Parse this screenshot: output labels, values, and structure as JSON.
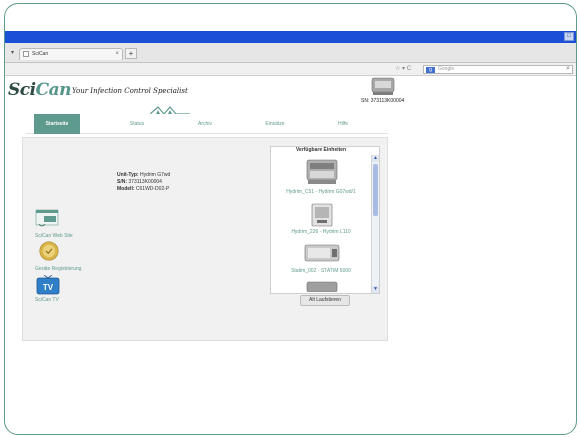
{
  "browser": {
    "tab_title": "SciCan",
    "new_tab_label": "+",
    "search_placeholder": "Google",
    "window_button": "□"
  },
  "header": {
    "logo_main": "Sci",
    "logo_accent": "Can",
    "tagline": "Your Infection Control Specialist",
    "serial_label": "SN: 373113K00004"
  },
  "menu": {
    "items": [
      {
        "label": "Startseite"
      },
      {
        "label": "Status"
      },
      {
        "label": "Archiv"
      },
      {
        "label": "Einsätze"
      },
      {
        "label": "Hilfe"
      }
    ]
  },
  "unit_info": {
    "type_key": "Unit-Typ:",
    "type_value": "Hydrim G7wd",
    "sn_key": "S/N:",
    "sn_value": "373113K00004",
    "model_key": "Modell:",
    "model_value": "C61WD-D02-P"
  },
  "sidebar": {
    "links": [
      {
        "label": "SciCan Web Site",
        "icon": "website-icon"
      },
      {
        "label": "Geräte Registrierung",
        "icon": "registration-seal-icon"
      },
      {
        "label": "SciCan TV",
        "icon": "tv-icon"
      }
    ]
  },
  "available_units": {
    "title": "Verfügbare Einheiten",
    "items": [
      {
        "label": "Hydrim_C51 - Hydrim G07wd/1"
      },
      {
        "label": "Hydrim_226 - Hydrim L110"
      },
      {
        "label": "Statim_002 - STATIM 5000"
      }
    ],
    "reload_button": "Alt Laufstieren"
  },
  "colors": {
    "accent": "#5f9a8e",
    "titlebar": "#1a4fd6"
  }
}
